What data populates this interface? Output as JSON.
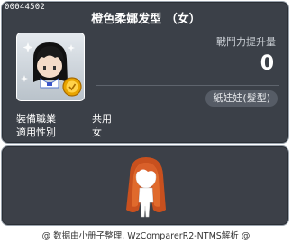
{
  "item": {
    "id": "00044502",
    "name": "橙色柔娜发型 （女）"
  },
  "power": {
    "label": "戰鬥力提升量",
    "value": "0"
  },
  "category_tag": "紙娃娃(髮型)",
  "stats": [
    {
      "label": "裝備職業",
      "value": "共用"
    },
    {
      "label": "適用性別",
      "value": "女"
    }
  ],
  "icons": {
    "item_icon": "hairstyle-icon",
    "coin_badge": "coin-icon",
    "preview": "character-preview"
  },
  "footer": "@ 数据由小册子整理, WzComparerR2-NTMS解析 @",
  "colors": {
    "panel_bg": "#3b4048",
    "hair": "#c8501e",
    "coin": "#e8a400"
  }
}
